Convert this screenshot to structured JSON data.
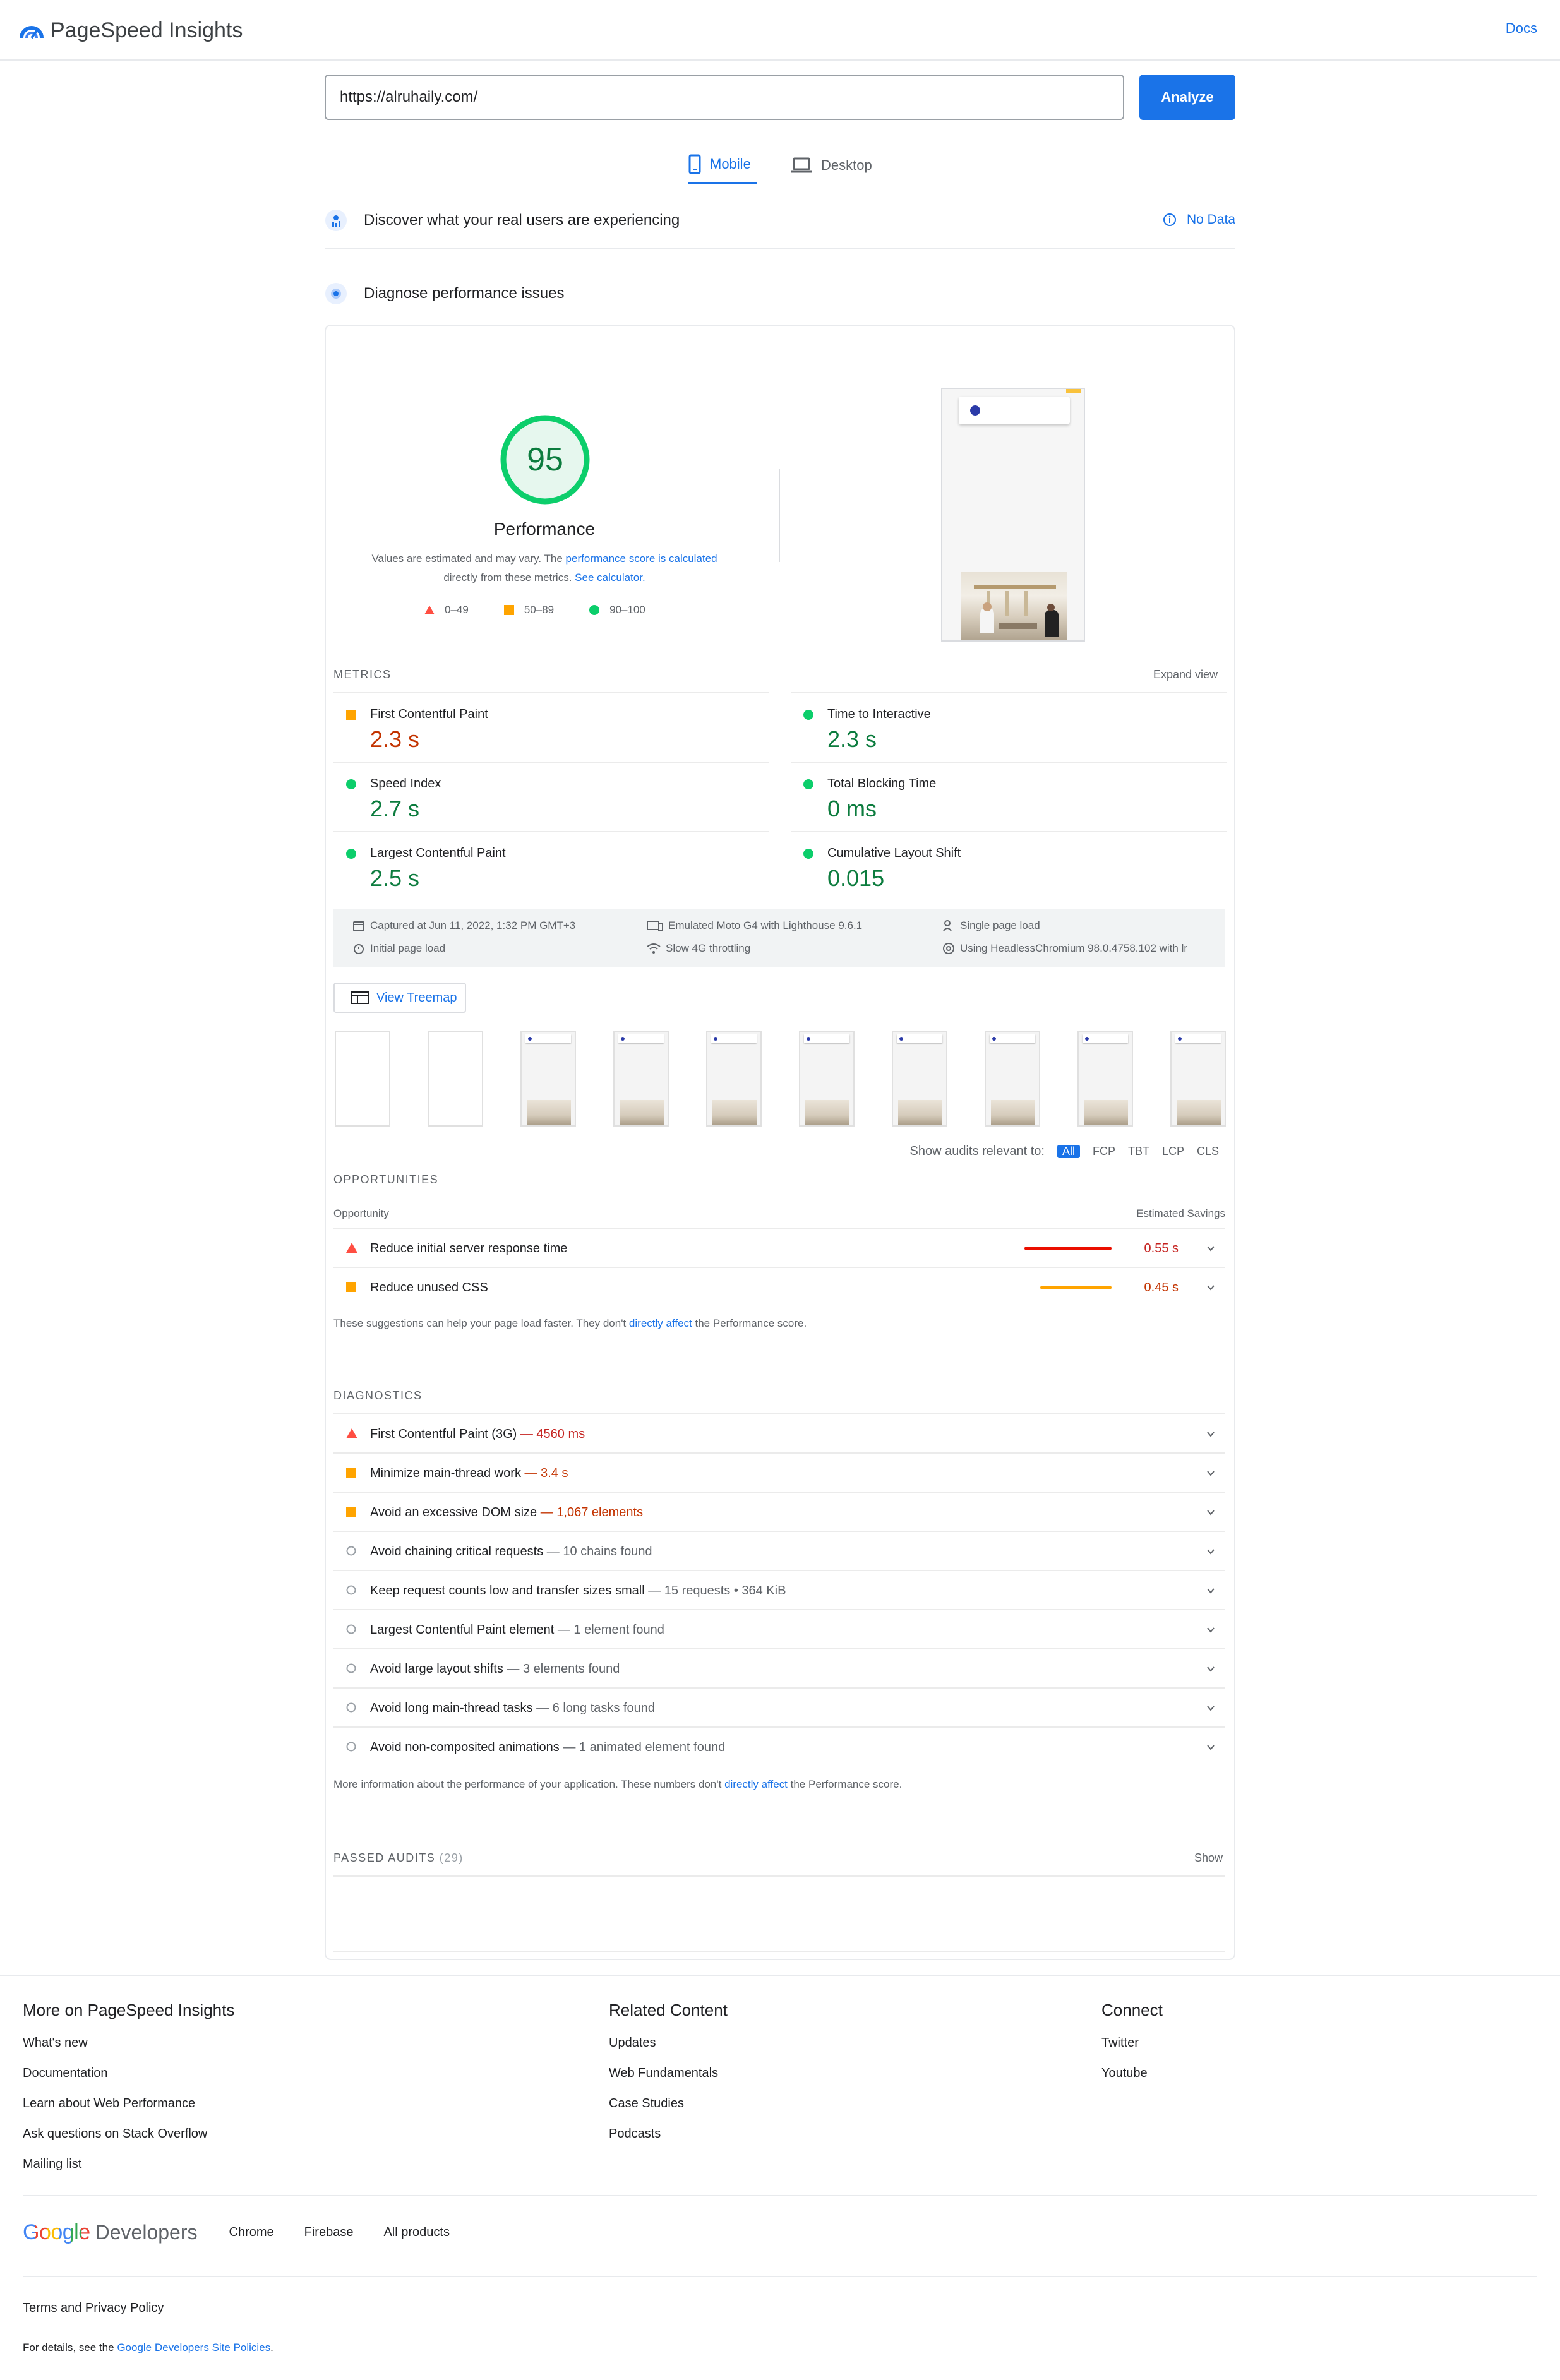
{
  "header": {
    "app_title": "PageSpeed Insights",
    "docs_label": "Docs"
  },
  "search": {
    "url_value": "https://alruhaily.com/",
    "analyze_label": "Analyze"
  },
  "tabs": [
    {
      "label": "Mobile",
      "active": true
    },
    {
      "label": "Desktop",
      "active": false
    }
  ],
  "field_data": {
    "title": "Discover what your real users are experiencing",
    "status": "No Data"
  },
  "lab": {
    "title": "Diagnose performance issues",
    "score": "95",
    "score_label": "Performance",
    "note_1": "Values are estimated and may vary. The ",
    "note_link_1": "performance score is calculated",
    "note_2": "directly from these metrics. ",
    "note_link_2": "See calculator.",
    "legend": [
      {
        "label": "0–49"
      },
      {
        "label": "50–89"
      },
      {
        "label": "90–100"
      }
    ]
  },
  "metrics": {
    "section_label": "METRICS",
    "expand_label": "Expand view",
    "items": [
      {
        "name": "First Contentful Paint",
        "value": "2.3 s",
        "rating": "average"
      },
      {
        "name": "Time to Interactive",
        "value": "2.3 s",
        "rating": "pass"
      },
      {
        "name": "Speed Index",
        "value": "2.7 s",
        "rating": "pass"
      },
      {
        "name": "Total Blocking Time",
        "value": "0 ms",
        "rating": "pass"
      },
      {
        "name": "Largest Contentful Paint",
        "value": "2.5 s",
        "rating": "pass"
      },
      {
        "name": "Cumulative Layout Shift",
        "value": "0.015",
        "rating": "pass"
      }
    ]
  },
  "runtime": {
    "captured": "Captured at Jun 11, 2022, 1:32 PM GMT+3",
    "device": "Emulated Moto G4 with Lighthouse 9.6.1",
    "session": "Single page load",
    "initial": "Initial page load",
    "throttle": "Slow 4G throttling",
    "browser": "Using HeadlessChromium 98.0.4758.102 with lr"
  },
  "treemap_label": "View Treemap",
  "filter": {
    "label": "Show audits relevant to:",
    "chips": [
      "All",
      "FCP",
      "TBT",
      "LCP",
      "CLS"
    ]
  },
  "opportunities": {
    "section_label": "OPPORTUNITIES",
    "col_left": "Opportunity",
    "col_right": "Estimated Savings",
    "items": [
      {
        "name": "Reduce initial server response time",
        "savings": "0.55 s",
        "rating": "fail",
        "fraction": 1.0
      },
      {
        "name": "Reduce unused CSS",
        "savings": "0.45 s",
        "rating": "average",
        "fraction": 0.82
      }
    ],
    "footnote_1": "These suggestions can help your page load faster. They don't ",
    "footnote_link": "directly affect",
    "footnote_2": " the Performance score."
  },
  "diagnostics": {
    "section_label": "DIAGNOSTICS",
    "items": [
      {
        "name": "First Contentful Paint (3G)",
        "detail": "— 4560 ms",
        "rating": "fail"
      },
      {
        "name": "Minimize main-thread work",
        "detail": "— 3.4 s",
        "rating": "average"
      },
      {
        "name": "Avoid an excessive DOM size",
        "detail": "— 1,067 elements",
        "rating": "average"
      },
      {
        "name": "Avoid chaining critical requests",
        "detail": "— 10 chains found",
        "rating": "info"
      },
      {
        "name": "Keep request counts low and transfer sizes small",
        "detail": "— 15 requests • 364 KiB",
        "rating": "info"
      },
      {
        "name": "Largest Contentful Paint element",
        "detail": "— 1 element found",
        "rating": "info"
      },
      {
        "name": "Avoid large layout shifts",
        "detail": "— 3 elements found",
        "rating": "info"
      },
      {
        "name": "Avoid long main-thread tasks",
        "detail": "— 6 long tasks found",
        "rating": "info"
      },
      {
        "name": "Avoid non-composited animations",
        "detail": "— 1 animated element found",
        "rating": "info"
      }
    ],
    "footnote_1": "More information about the performance of your application. These numbers don't ",
    "footnote_link": "directly affect",
    "footnote_2": " the Performance score."
  },
  "passed": {
    "label": "PASSED AUDITS",
    "count": "(29)",
    "show_label": "Show"
  },
  "footer": {
    "col1": {
      "heading": "More on PageSpeed Insights",
      "links": [
        "What's new",
        "Documentation",
        "Learn about Web Performance",
        "Ask questions on Stack Overflow",
        "Mailing list"
      ]
    },
    "col2": {
      "heading": "Related Content",
      "links": [
        "Updates",
        "Web Fundamentals",
        "Case Studies",
        "Podcasts"
      ]
    },
    "col3": {
      "heading": "Connect",
      "links": [
        "Twitter",
        "Youtube"
      ]
    },
    "brand_google": "Google",
    "brand_developers": "Developers",
    "bottom_links": [
      "Chrome",
      "Firebase",
      "All products"
    ],
    "terms": "Terms and Privacy Policy",
    "details_prefix": "For details, see the ",
    "details_link": "Google Developers Site Policies",
    "details_suffix": "."
  },
  "colors": {
    "accent": "#1a73e8",
    "pass": "#0cce6b",
    "average": "#ffa400",
    "fail": "#ff4e42"
  }
}
